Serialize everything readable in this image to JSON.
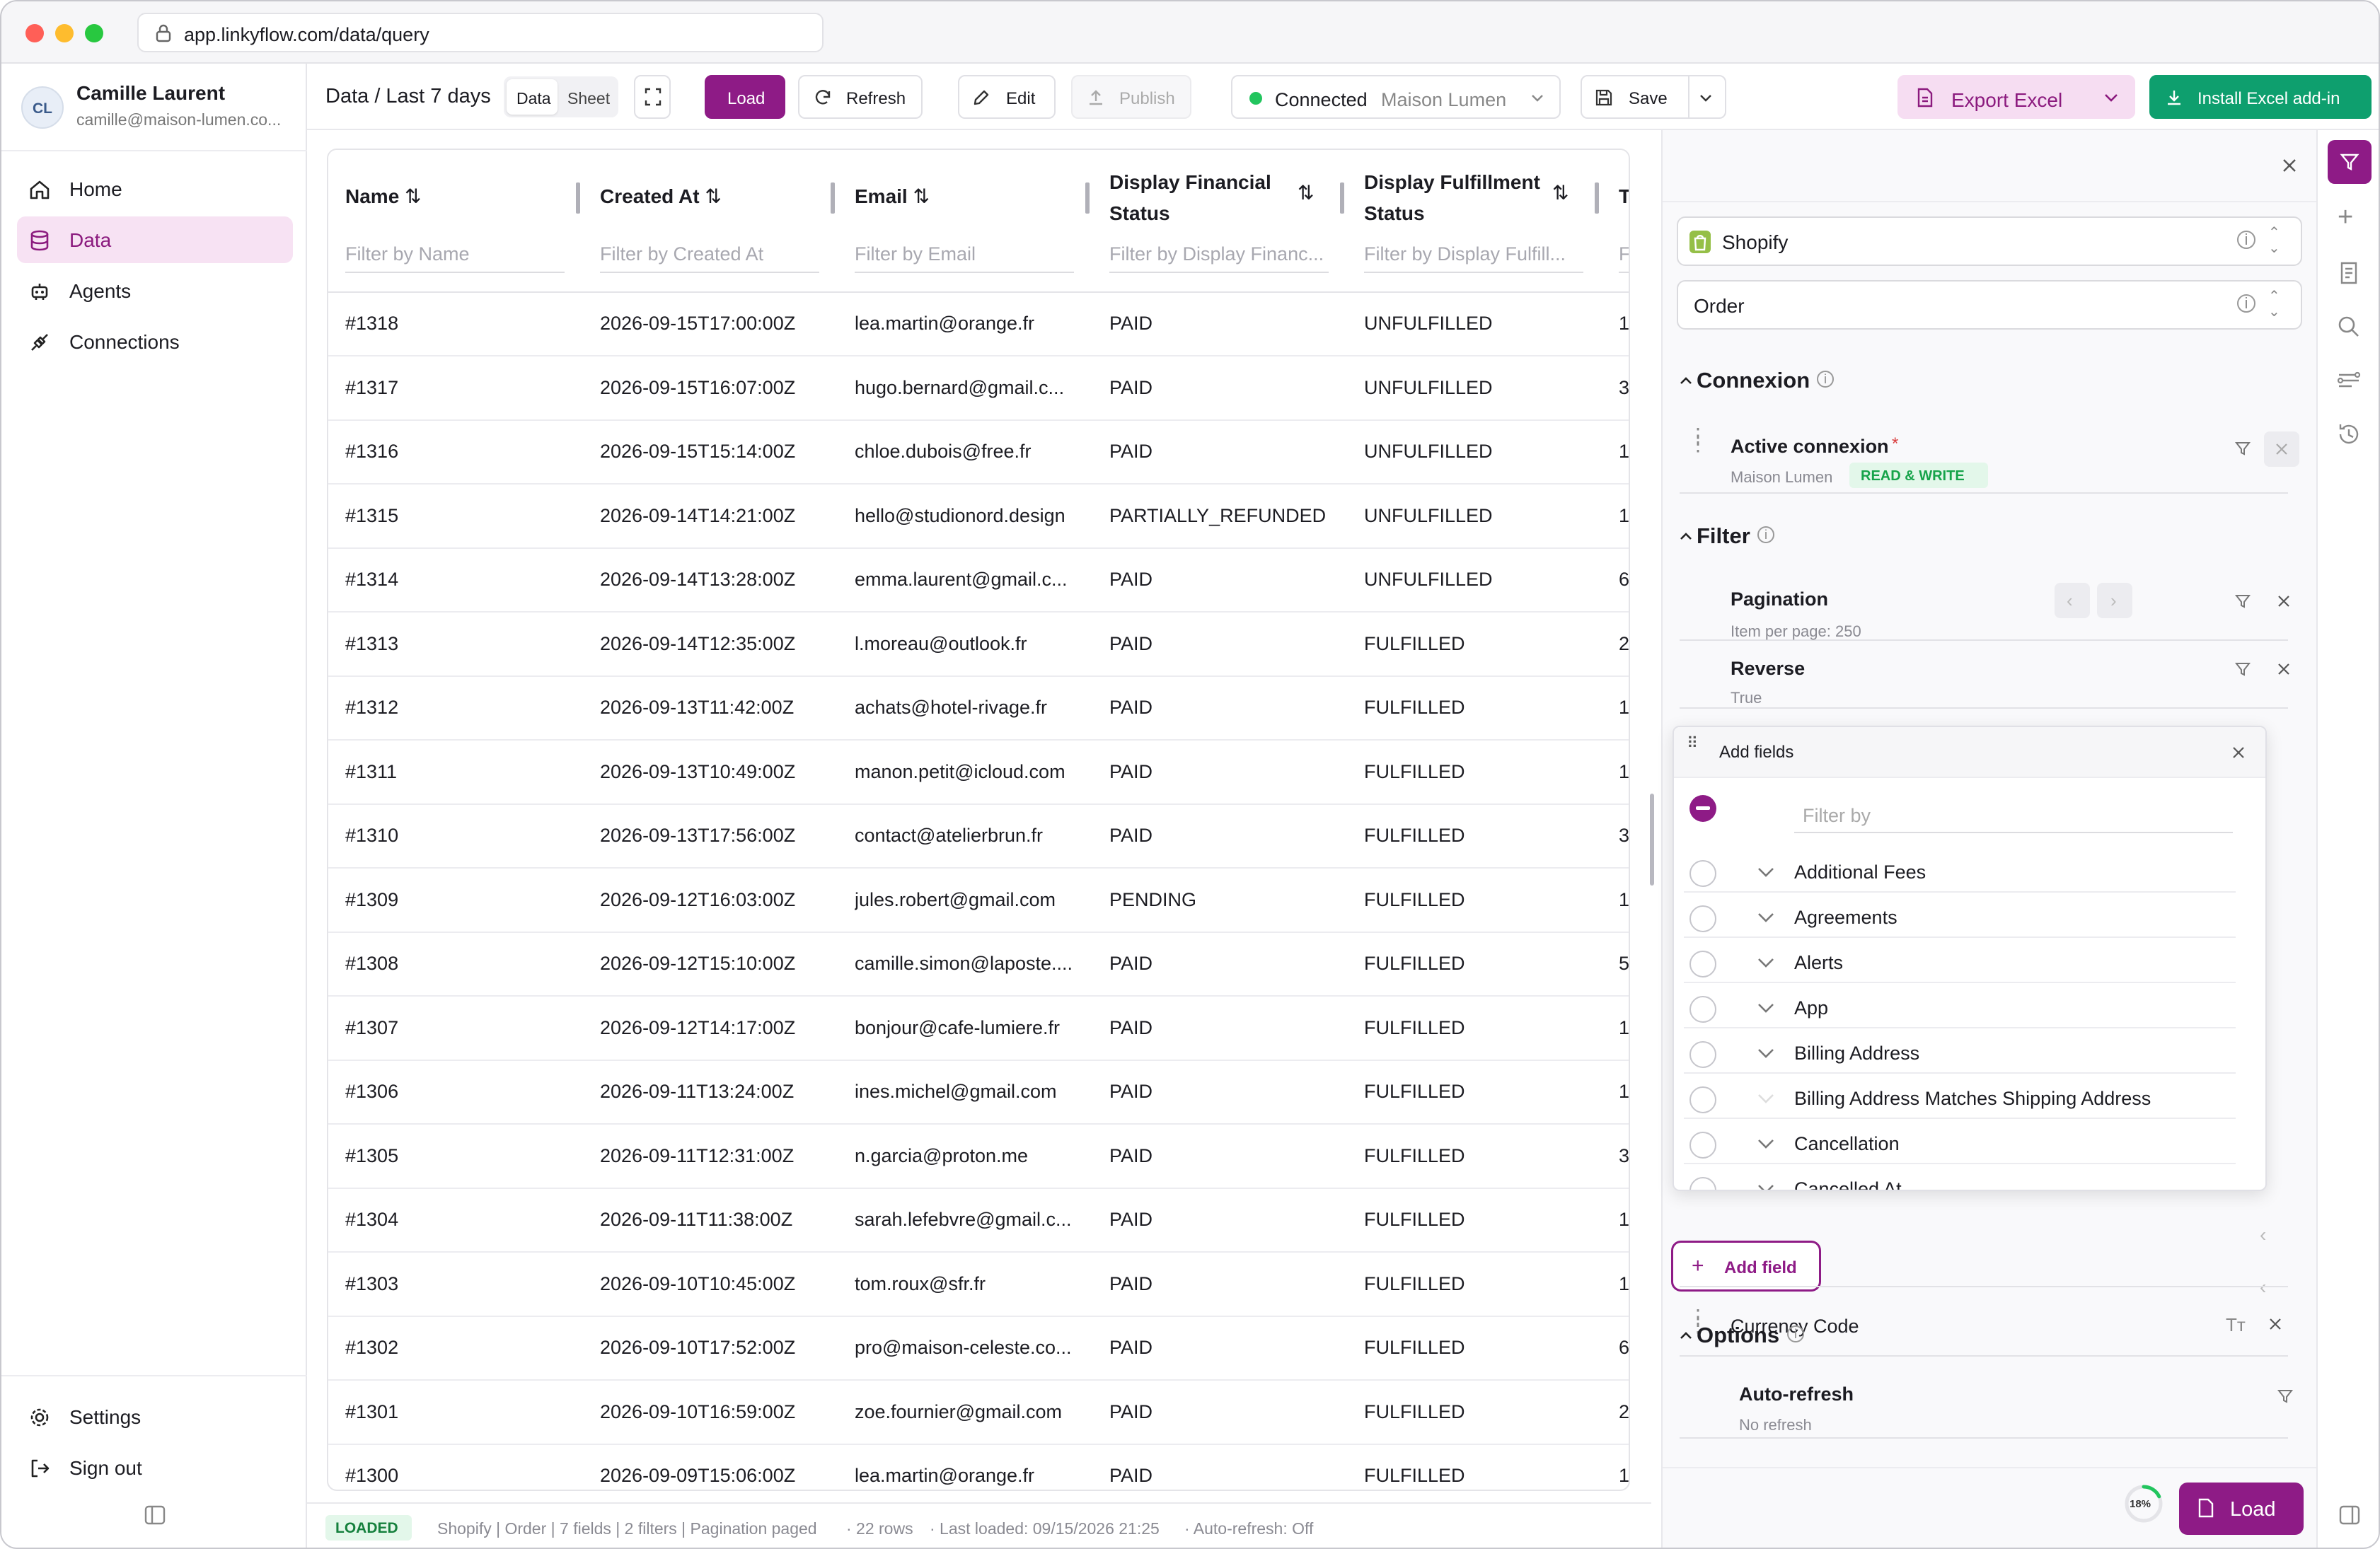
{
  "browser": {
    "url": "app.linkyflow.com/data/query"
  },
  "user": {
    "initials": "CL",
    "name": "Camille Laurent",
    "email": "camille@maison-lumen.co..."
  },
  "sidebar": {
    "items": [
      {
        "label": "Home",
        "icon": "home-icon"
      },
      {
        "label": "Data",
        "icon": "database-icon"
      },
      {
        "label": "Agents",
        "icon": "robot-icon"
      },
      {
        "label": "Connections",
        "icon": "plug-icon"
      }
    ],
    "settings_label": "Settings",
    "signout_label": "Sign out"
  },
  "toolbar": {
    "breadcrumb": "Data / Last 7 days",
    "view_data": "Data",
    "view_sheet": "Sheet",
    "load": "Load",
    "refresh": "Refresh",
    "edit": "Edit",
    "publish": "Publish",
    "connected": "Connected",
    "connection_name": "Maison Lumen",
    "save": "Save",
    "export": "Export Excel",
    "install": "Install Excel add-in"
  },
  "table": {
    "columns": [
      {
        "name": "Name",
        "filter": "Filter by Name"
      },
      {
        "name": "Created At",
        "filter": "Filter by Created At"
      },
      {
        "name": "Email",
        "filter": "Filter by Email"
      },
      {
        "name": "Display Financial Status",
        "filter": "Filter by Display Financ..."
      },
      {
        "name": "Display Fulfillment Status",
        "filter": "Filter by Display Fulfill..."
      },
      {
        "name": "T",
        "filter": "F"
      }
    ],
    "rows": [
      [
        "#1318",
        "2026-09-15T17:00:00Z",
        "lea.martin@orange.fr",
        "PAID",
        "UNFULFILLED",
        "1"
      ],
      [
        "#1317",
        "2026-09-15T16:07:00Z",
        "hugo.bernard@gmail.c...",
        "PAID",
        "UNFULFILLED",
        "3"
      ],
      [
        "#1316",
        "2026-09-15T15:14:00Z",
        "chloe.dubois@free.fr",
        "PAID",
        "UNFULFILLED",
        "1"
      ],
      [
        "#1315",
        "2026-09-14T14:21:00Z",
        "hello@studionord.design",
        "PARTIALLY_REFUNDED",
        "UNFULFILLED",
        "1"
      ],
      [
        "#1314",
        "2026-09-14T13:28:00Z",
        "emma.laurent@gmail.c...",
        "PAID",
        "UNFULFILLED",
        "6"
      ],
      [
        "#1313",
        "2026-09-14T12:35:00Z",
        "l.moreau@outlook.fr",
        "PAID",
        "FULFILLED",
        "2"
      ],
      [
        "#1312",
        "2026-09-13T11:42:00Z",
        "achats@hotel-rivage.fr",
        "PAID",
        "FULFILLED",
        "1"
      ],
      [
        "#1311",
        "2026-09-13T10:49:00Z",
        "manon.petit@icloud.com",
        "PAID",
        "FULFILLED",
        "1"
      ],
      [
        "#1310",
        "2026-09-13T17:56:00Z",
        "contact@atelierbrun.fr",
        "PAID",
        "FULFILLED",
        "3"
      ],
      [
        "#1309",
        "2026-09-12T16:03:00Z",
        "jules.robert@gmail.com",
        "PENDING",
        "FULFILLED",
        "1"
      ],
      [
        "#1308",
        "2026-09-12T15:10:00Z",
        "camille.simon@laposte....",
        "PAID",
        "FULFILLED",
        "5"
      ],
      [
        "#1307",
        "2026-09-12T14:17:00Z",
        "bonjour@cafe-lumiere.fr",
        "PAID",
        "FULFILLED",
        "1"
      ],
      [
        "#1306",
        "2026-09-11T13:24:00Z",
        "ines.michel@gmail.com",
        "PAID",
        "FULFILLED",
        "1"
      ],
      [
        "#1305",
        "2026-09-11T12:31:00Z",
        "n.garcia@proton.me",
        "PAID",
        "FULFILLED",
        "3"
      ],
      [
        "#1304",
        "2026-09-11T11:38:00Z",
        "sarah.lefebvre@gmail.c...",
        "PAID",
        "FULFILLED",
        "1"
      ],
      [
        "#1303",
        "2026-09-10T10:45:00Z",
        "tom.roux@sfr.fr",
        "PAID",
        "FULFILLED",
        "1"
      ],
      [
        "#1302",
        "2026-09-10T17:52:00Z",
        "pro@maison-celeste.co...",
        "PAID",
        "FULFILLED",
        "6"
      ],
      [
        "#1301",
        "2026-09-10T16:59:00Z",
        "zoe.fournier@gmail.com",
        "PAID",
        "FULFILLED",
        "2"
      ],
      [
        "#1300",
        "2026-09-09T15:06:00Z",
        "lea.martin@orange.fr",
        "PAID",
        "FULFILLED",
        "1"
      ]
    ]
  },
  "status": {
    "badge": "LOADED",
    "summary": "Shopify | Order | 7 fields | 2 filters | Pagination paged",
    "rows": "· 22 rows",
    "last_loaded": "· Last loaded: 09/15/2026 21:25",
    "auto_refresh": "· Auto-refresh: Off"
  },
  "panel": {
    "source": "Shopify",
    "object": "Order",
    "connexion_title": "Connexion",
    "active_connexion": "Active connexion",
    "required_mark": "*",
    "connexion_name": "Maison Lumen",
    "connexion_mode": "READ & WRITE",
    "filter_title": "Filter",
    "pagination_title": "Pagination",
    "pagination_sub": "Item per page: 250",
    "reverse_title": "Reverse",
    "reverse_sub": "True",
    "add_fields_title": "Add fields",
    "filter_placeholder": "Filter by",
    "field_options": [
      "Additional Fees",
      "Agreements",
      "Alerts",
      "App",
      "Billing Address",
      "Billing Address Matches Shipping Address",
      "Cancellation",
      "Cancelled At"
    ],
    "currency_code": "Currency Code",
    "add_field": "Add field",
    "options_title": "Options",
    "auto_refresh_title": "Auto-refresh",
    "auto_refresh_sub": "No refresh",
    "progress": "18%",
    "load": "Load"
  },
  "colors": {
    "accent": "#8e1b86",
    "green": "#0e9f6e",
    "connected": "#22c55e",
    "export_bg": "#f6ddf2"
  }
}
